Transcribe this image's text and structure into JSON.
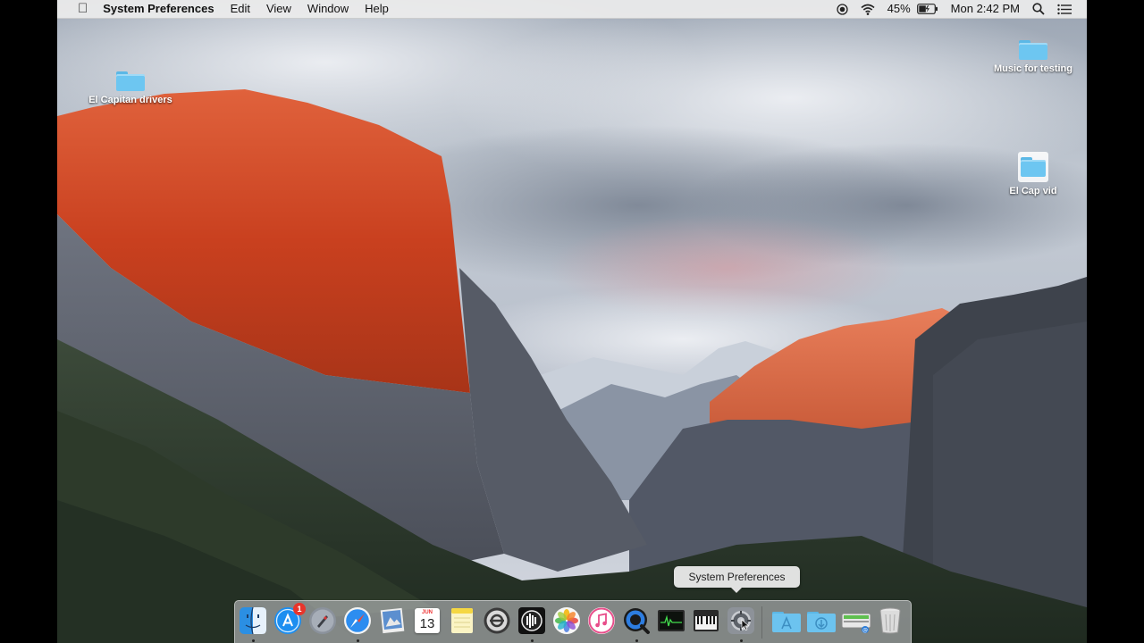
{
  "menubar": {
    "app_name": "System Preferences",
    "menus": [
      "Edit",
      "View",
      "Window",
      "Help"
    ],
    "battery": "45%",
    "clock": "Mon 2:42 PM",
    "status_icons": [
      "screen-record-icon",
      "wifi-icon",
      "battery-icon",
      "spotlight-icon",
      "notification-center-icon"
    ]
  },
  "desktop": {
    "icons": [
      {
        "label": "El Capitan drivers",
        "icon": "folder-icon"
      },
      {
        "label": "Music for testing",
        "icon": "folder-icon"
      },
      {
        "label": "El Cap vid",
        "icon": "video-folder-icon"
      }
    ]
  },
  "tooltip": {
    "text": "System Preferences"
  },
  "dock": {
    "items": [
      {
        "name": "Finder",
        "icon": "finder-icon",
        "running": true
      },
      {
        "name": "App Store",
        "icon": "app-store-icon",
        "badge": "1",
        "running": false
      },
      {
        "name": "Launchpad",
        "icon": "launchpad-icon",
        "running": false
      },
      {
        "name": "Safari",
        "icon": "safari-icon",
        "running": true
      },
      {
        "name": "Preview",
        "icon": "preview-icon",
        "running": false
      },
      {
        "name": "Calendar",
        "icon": "calendar-icon",
        "month": "JUN",
        "day": "13",
        "running": false
      },
      {
        "name": "Notes",
        "icon": "notes-icon",
        "running": false
      },
      {
        "name": "Utility",
        "icon": "utility-app-icon",
        "running": false
      },
      {
        "name": "Audio App",
        "icon": "audio-app-icon",
        "running": true
      },
      {
        "name": "Photos",
        "icon": "photos-icon",
        "running": false
      },
      {
        "name": "iTunes",
        "icon": "itunes-icon",
        "running": false
      },
      {
        "name": "QuickTime Player",
        "icon": "quicktime-icon",
        "running": true
      },
      {
        "name": "Activity Monitor",
        "icon": "activity-monitor-icon",
        "running": false
      },
      {
        "name": "Audio MIDI Setup",
        "icon": "midi-keyboard-icon",
        "running": false
      },
      {
        "name": "System Preferences",
        "icon": "system-preferences-icon",
        "running": true
      },
      {
        "name": "Applications",
        "icon": "applications-folder-icon",
        "running": false
      },
      {
        "name": "Downloads",
        "icon": "downloads-folder-icon",
        "running": false
      },
      {
        "name": "Network Drive",
        "icon": "network-drive-icon",
        "running": false
      },
      {
        "name": "Trash",
        "icon": "trash-icon",
        "running": false
      }
    ]
  }
}
